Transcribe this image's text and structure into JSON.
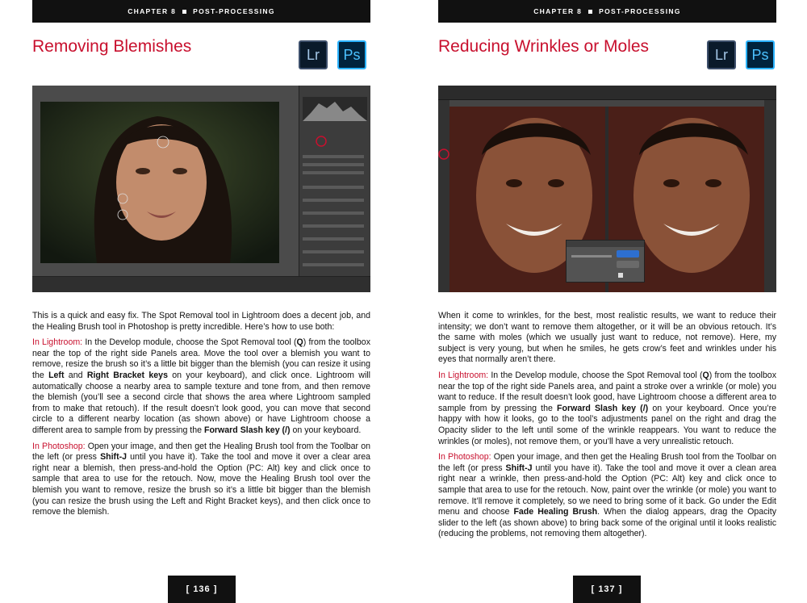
{
  "chapter_label": "CHAPTER 8",
  "chapter_name": "POST-PROCESSING",
  "app_icons": {
    "lightroom": "Lr",
    "photoshop": "Ps"
  },
  "left": {
    "title": "Removing Blemishes",
    "intro": "This is a quick and easy fix. The Spot Removal tool in Lightroom does a decent job, and the Healing Brush tool in Photoshop is pretty incredible. Here’s how to use both:",
    "lr_lead": "In Lightroom:",
    "lr_t1": " In the Develop module, choose the Spot Removal tool (",
    "lr_k1": "Q",
    "lr_t2": ") from the toolbox near the top of the right side Panels area. Move the tool over a blemish you want to remove, resize the brush so it’s a little bit bigger than the blemish (you can resize it using the ",
    "lr_k2": "Left",
    "lr_t3": " and ",
    "lr_k3": "Right Bracket keys",
    "lr_t4": " on your keyboard), and click once. Lightroom will automatically choose a nearby area to sample texture and tone from, and then remove the blemish (you’ll see a second circle that shows the area where Lightroom sampled from to make that retouch). If the result doesn’t look good, you can move that second circle to a different nearby location (as shown above) or have Lightroom choose a different area to sample from by pressing the ",
    "lr_k4": "Forward Slash key (/)",
    "lr_t5": " on your keyboard.",
    "ps_lead": "In Photoshop:",
    "ps_t1": " Open your image, and then get the Healing Brush tool from the Toolbar on the left (or press ",
    "ps_k1": "Shift-J",
    "ps_t2": " until you have it). Take the tool and move it over a clear area right near a blemish, then press-and-hold the Option (PC: Alt) key and click once to sample that area to use for the retouch. Now, move the Healing Brush tool over the blemish you want to remove, resize the brush so it’s a little bit bigger than the blemish (you can resize the brush using the Left and Right Bracket keys), and then click once to remove the blemish.",
    "page_number": "[ 136 ]"
  },
  "right": {
    "title": "Reducing Wrinkles or Moles",
    "intro": "When it come to wrinkles, for the best, most realistic results, we want to reduce their intensity; we don’t want to remove them altogether, or it will be an obvious retouch. It’s the same with moles (which we usually just want to reduce, not remove). Here, my subject is very young, but when he smiles, he gets crow’s feet and wrinkles under his eyes that normally aren’t there.",
    "lr_lead": "In Lightroom:",
    "lr_t1": " In the Develop module, choose the Spot Removal tool (",
    "lr_k1": "Q",
    "lr_t2": ") from the toolbox near the top of the right side Panels area, and paint a stroke over a wrinkle (or mole) you want to reduce. If the result doesn’t look good, have Lightroom choose a different area to sample from by pressing the ",
    "lr_k2": "Forward Slash key (/)",
    "lr_t3": " on your keyboard. Once you’re happy with how it looks, go to the tool’s adjustments panel on the right and drag the Opacity slider to the left until some of the wrinkle reappears. You want to reduce the wrinkles (or moles), not remove them, or you’ll have a very unrealistic retouch.",
    "ps_lead": "In Photoshop:",
    "ps_t1": " Open your image, and then get the Healing Brush tool from the Toolbar on the left (or press ",
    "ps_k1": "Shift-J",
    "ps_t2": " until you have it). Take the tool and move it over a clean area right near a wrinkle, then press-and-hold the Option (PC: Alt) key and click once to sample that area to use for the retouch. Now, paint over the wrinkle (or mole) you want to remove. It’ll remove it completely, so we need to bring some of it back. Go under the Edit menu and choose ",
    "ps_k2": "Fade Healing Brush",
    "ps_t3": ". When the dialog appears, drag the Opacity slider to the left (as shown above) to bring back some of the original until it looks realistic (reducing the problems, not removing them altogether).",
    "page_number": "[ 137 ]"
  },
  "colors": {
    "accent": "#c8102e",
    "bar": "#111111"
  }
}
